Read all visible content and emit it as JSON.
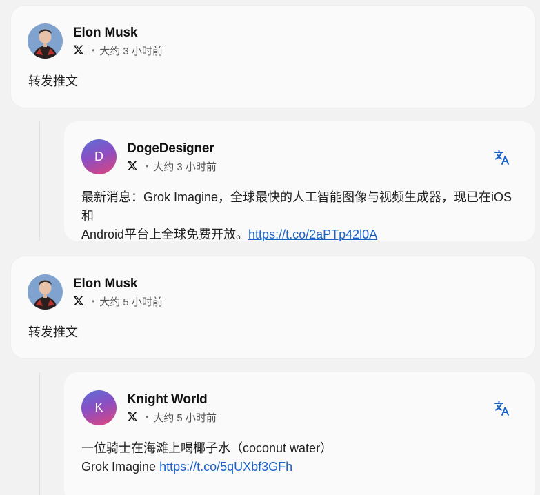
{
  "posts": [
    {
      "author": "Elon Musk",
      "platform_icon": "x-logo-icon",
      "separator": "•",
      "time": "大约 3 小时前",
      "text": "转发推文",
      "quote": {
        "avatar_letter": "D",
        "author": "DogeDesigner",
        "separator": "•",
        "time": "大约 3 小时前",
        "text_line1": "最新消息：Grok Imagine，全球最快的人工智能图像与视频生成器，现已在iOS和",
        "text_line2": "Android平台上全球免费开放。",
        "link": "https://t.co/2aPTp42l0A"
      }
    },
    {
      "author": "Elon Musk",
      "platform_icon": "x-logo-icon",
      "separator": "•",
      "time": "大约 5 小时前",
      "text": "转发推文",
      "quote": {
        "avatar_letter": "K",
        "author": "Knight World",
        "separator": "•",
        "time": "大约 5 小时前",
        "text_line1": "一位骑士在海滩上喝椰子水（coconut water）",
        "text_line2": "Grok Imagine",
        "link": "https://t.co/5qUXbf3GFh"
      }
    }
  ],
  "colors": {
    "link": "#1a62c7",
    "translate_icon": "#1a62c7",
    "avatar_gradient": [
      "#5b6fd6",
      "#8a4fc4",
      "#e0447a"
    ]
  }
}
